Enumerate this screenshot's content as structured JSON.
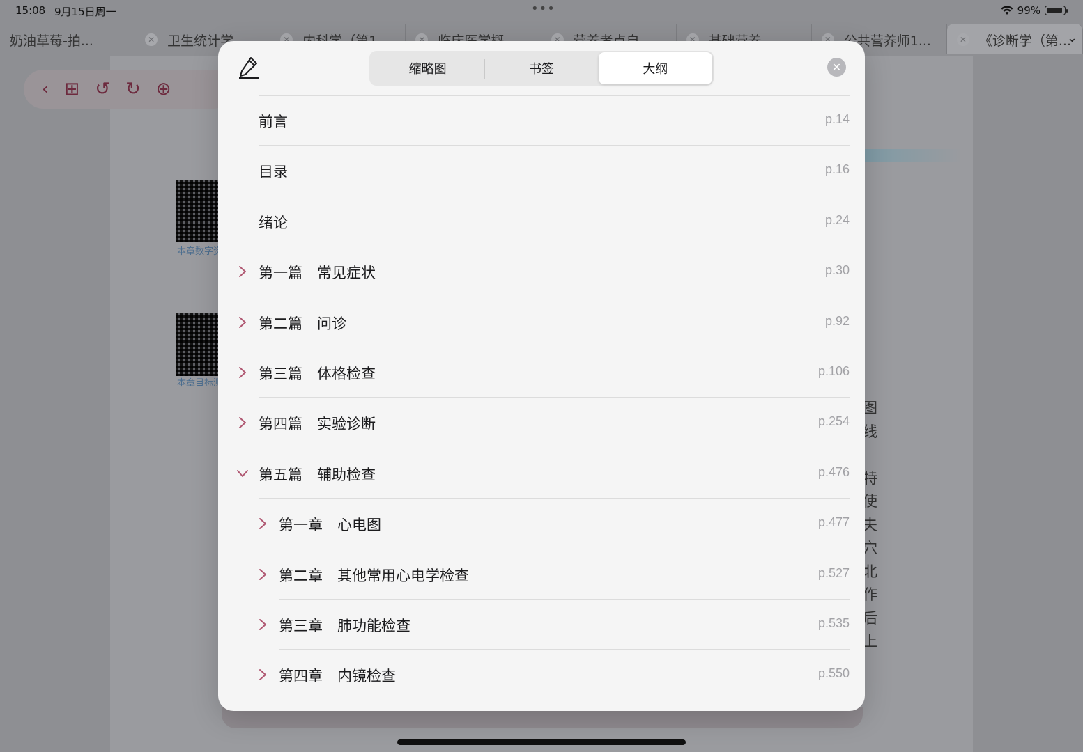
{
  "status_bar": {
    "time": "15:08",
    "date": "9月15日周一",
    "battery": "99%"
  },
  "tabs": [
    {
      "label": "奶油草莓-拍..."
    },
    {
      "label": "卫生统计学..."
    },
    {
      "label": "内科学（第1..."
    },
    {
      "label": "临床医学概..."
    },
    {
      "label": "营养考点自..."
    },
    {
      "label": "基础营养..."
    },
    {
      "label": "公共营养师1..."
    },
    {
      "label": "《诊断学（第..."
    }
  ],
  "background_page": {
    "qr_caption_1": "本章数字资",
    "qr_caption_2": "本章目标测",
    "side_text": [
      "图",
      "线",
      "",
      "特",
      "使",
      "夫",
      "穴",
      "北",
      "作",
      "后",
      "上"
    ]
  },
  "modal": {
    "segments": [
      {
        "label": "缩略图",
        "active": false
      },
      {
        "label": "书签",
        "active": false
      },
      {
        "label": "大纲",
        "active": true
      }
    ],
    "outline": [
      {
        "title": "前言",
        "page": "p.14",
        "level": 0,
        "chevron": "none"
      },
      {
        "title": "目录",
        "page": "p.16",
        "level": 0,
        "chevron": "none"
      },
      {
        "title": "绪论",
        "page": "p.24",
        "level": 0,
        "chevron": "none"
      },
      {
        "title": "第一篇　常见症状",
        "page": "p.30",
        "level": 0,
        "chevron": "right"
      },
      {
        "title": "第二篇　问诊",
        "page": "p.92",
        "level": 0,
        "chevron": "right"
      },
      {
        "title": "第三篇　体格检查",
        "page": "p.106",
        "level": 0,
        "chevron": "right"
      },
      {
        "title": "第四篇　实验诊断",
        "page": "p.254",
        "level": 0,
        "chevron": "right"
      },
      {
        "title": "第五篇　辅助检查",
        "page": "p.476",
        "level": 0,
        "chevron": "down"
      },
      {
        "title": "第一章　心电图",
        "page": "p.477",
        "level": 1,
        "chevron": "right"
      },
      {
        "title": "第二章　其他常用心电学检查",
        "page": "p.527",
        "level": 1,
        "chevron": "right"
      },
      {
        "title": "第三章　肺功能检查",
        "page": "p.535",
        "level": 1,
        "chevron": "right"
      },
      {
        "title": "第四章　内镜检查",
        "page": "p.550",
        "level": 1,
        "chevron": "right"
      }
    ]
  },
  "colors": {
    "accent": "#b05872",
    "modal_bg": "#f5f5f5",
    "page_number": "#a2a2a6"
  }
}
